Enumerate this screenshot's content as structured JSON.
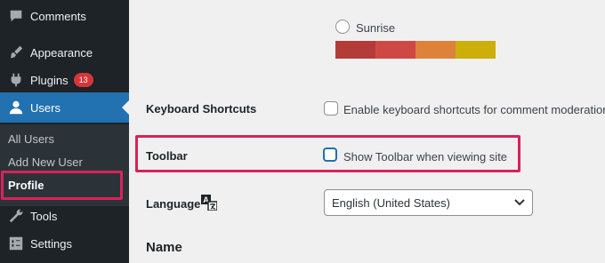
{
  "sidebar": {
    "items": [
      {
        "label": "Comments",
        "icon": "comments-icon"
      },
      {
        "label": "Appearance",
        "icon": "paintbrush-icon"
      },
      {
        "label": "Plugins",
        "icon": "plugin-icon",
        "badge": "13"
      },
      {
        "label": "Users",
        "icon": "users-icon"
      },
      {
        "label": "Tools",
        "icon": "wrench-icon"
      },
      {
        "label": "Settings",
        "icon": "settings-icon"
      }
    ],
    "submenu": [
      {
        "label": "All Users"
      },
      {
        "label": "Add New User"
      },
      {
        "label": "Profile"
      }
    ]
  },
  "color_scheme": {
    "label": "Sunrise",
    "colors": [
      "#b43c38",
      "#cf4944",
      "#dd823b",
      "#ccaf0b"
    ]
  },
  "keyboard_shortcuts": {
    "label": "Keyboard Shortcuts",
    "checkbox_label": "Enable keyboard shortcuts for comment moderation"
  },
  "toolbar": {
    "label": "Toolbar",
    "checkbox_label": "Show Toolbar when viewing site"
  },
  "language": {
    "label": "Language",
    "selected": "English (United States)"
  },
  "name_section": {
    "title": "Name"
  },
  "colors": {
    "sidebar_bg": "#1d2327",
    "active": "#2271b1",
    "highlight": "#d7235a",
    "badge": "#d63638"
  }
}
